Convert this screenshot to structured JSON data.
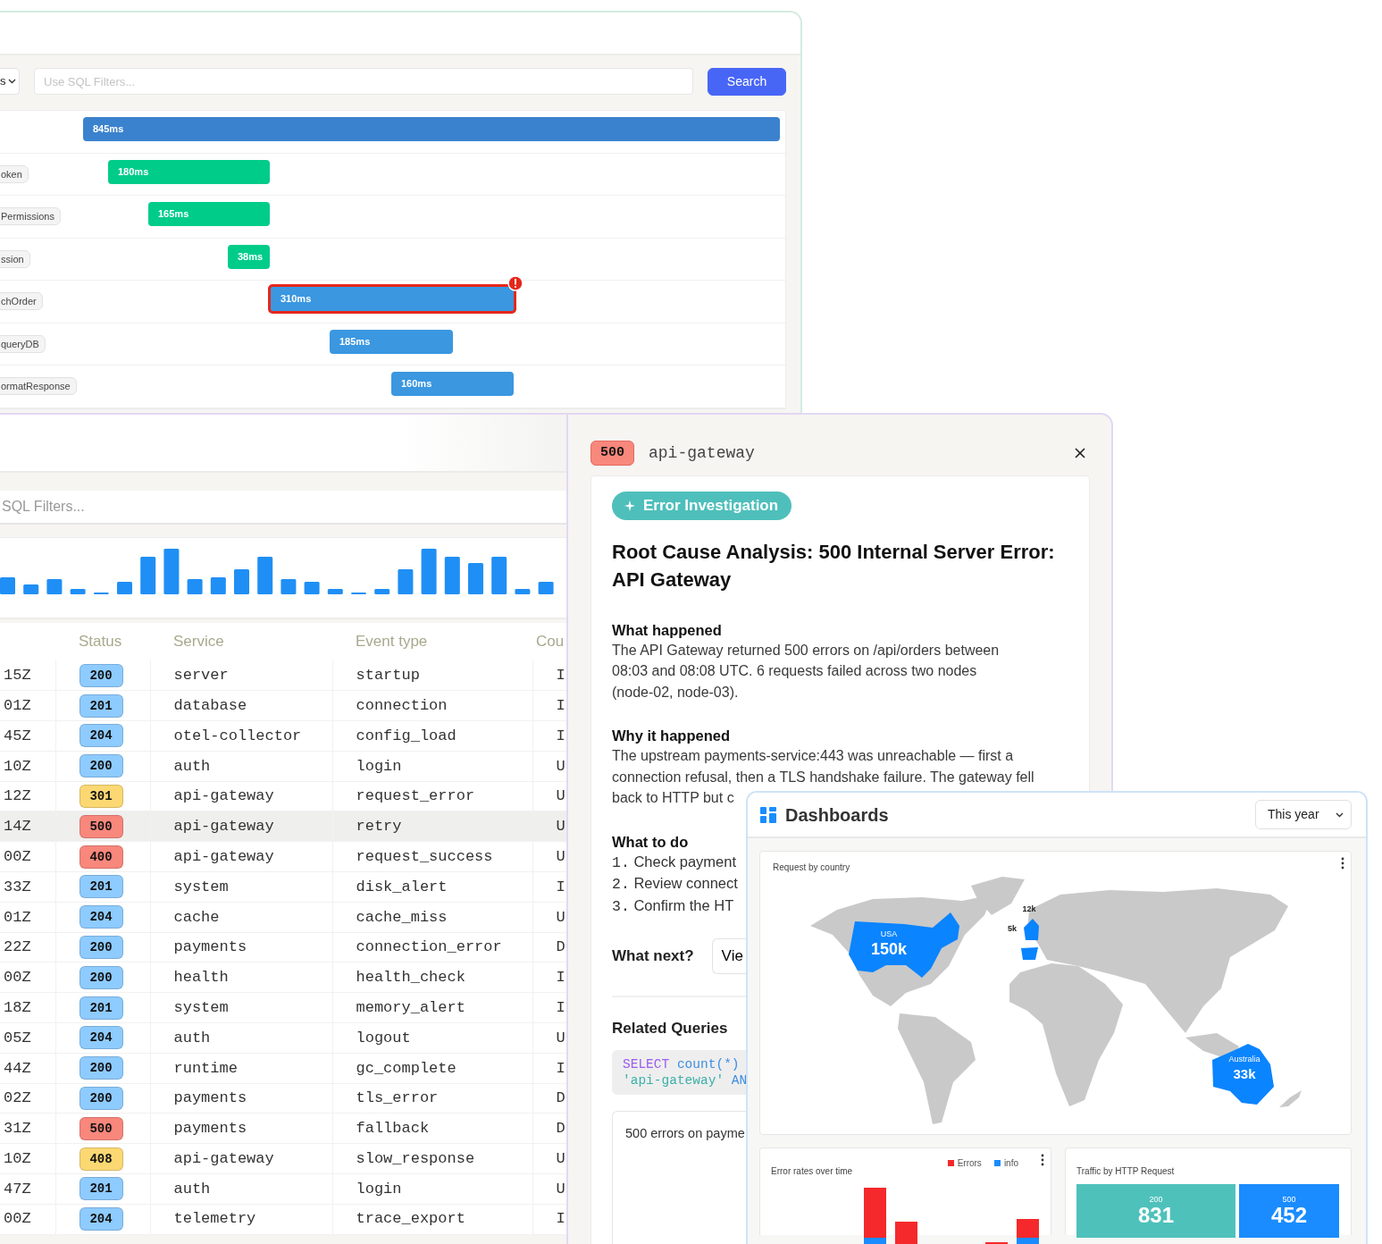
{
  "trace_window": {
    "filter": {
      "select": "s",
      "placeholder": "Use SQL Filters...",
      "button": "Search"
    },
    "spans": [
      {
        "duration": "845ms",
        "color": "#3b82ce",
        "error": false
      },
      {
        "label": "oken",
        "duration": "180ms",
        "color": "#00cc8a",
        "error": false
      },
      {
        "label": "Permissions",
        "duration": "165ms",
        "color": "#00cc8a",
        "error": false
      },
      {
        "label": "ssion",
        "duration": "38ms",
        "color": "#00cc8a",
        "error": false
      },
      {
        "label": "chOrder",
        "duration": "310ms",
        "color": "#3a97e0",
        "error": true
      },
      {
        "label": "queryDB",
        "duration": "185ms",
        "color": "#3a97e0",
        "error": false
      },
      {
        "label": "ormatResponse",
        "duration": "160ms",
        "color": "#3a97e0",
        "error": false
      }
    ]
  },
  "logs_window": {
    "filter": {
      "placeholder": "SQL Filters..."
    },
    "table": {
      "columns": [
        "Status",
        "Service",
        "Event type",
        "Cou"
      ],
      "rows": [
        {
          "time": "15Z",
          "status": "200",
          "color": "#8ecbff",
          "service": "server",
          "event": "startup",
          "column_5": "I",
          "selected": false
        },
        {
          "time": "01Z",
          "status": "201",
          "color": "#8ecbff",
          "service": "database",
          "event": "connection",
          "column_5": "I",
          "selected": false
        },
        {
          "time": "45Z",
          "status": "204",
          "color": "#8ecbff",
          "service": "otel-collector",
          "event": "config_load",
          "column_5": "I",
          "selected": false
        },
        {
          "time": "10Z",
          "status": "200",
          "color": "#8ecbff",
          "service": "auth",
          "event": "login",
          "column_5": "U",
          "selected": false
        },
        {
          "time": "12Z",
          "status": "301",
          "color": "#fcd873",
          "service": "api-gateway",
          "event": "request_error",
          "column_5": "U",
          "selected": false
        },
        {
          "time": "14Z",
          "status": "500",
          "color": "#f8877c",
          "service": "api-gateway",
          "event": "retry",
          "column_5": "U",
          "selected": true
        },
        {
          "time": "00Z",
          "status": "400",
          "color": "#f8877c",
          "service": "api-gateway",
          "event": "request_success",
          "column_5": "U",
          "selected": false
        },
        {
          "time": "33Z",
          "status": "201",
          "color": "#8ecbff",
          "service": "system",
          "event": "disk_alert",
          "column_5": "I",
          "selected": false
        },
        {
          "time": "01Z",
          "status": "204",
          "color": "#8ecbff",
          "service": "cache",
          "event": "cache_miss",
          "column_5": "U",
          "selected": false
        },
        {
          "time": "22Z",
          "status": "200",
          "color": "#8ecbff",
          "service": "payments",
          "event": "connection_error",
          "column_5": "D",
          "selected": false
        },
        {
          "time": "00Z",
          "status": "200",
          "color": "#8ecbff",
          "service": "health",
          "event": "health_check",
          "column_5": "I",
          "selected": false
        },
        {
          "time": "18Z",
          "status": "201",
          "color": "#8ecbff",
          "service": "system",
          "event": "memory_alert",
          "column_5": "I",
          "selected": false
        },
        {
          "time": "05Z",
          "status": "204",
          "color": "#8ecbff",
          "service": "auth",
          "event": "logout",
          "column_5": "U",
          "selected": false
        },
        {
          "time": "44Z",
          "status": "200",
          "color": "#8ecbff",
          "service": "runtime",
          "event": "gc_complete",
          "column_5": "I",
          "selected": false
        },
        {
          "time": "02Z",
          "status": "200",
          "color": "#8ecbff",
          "service": "payments",
          "event": "tls_error",
          "column_5": "D",
          "selected": false
        },
        {
          "time": "31Z",
          "status": "500",
          "color": "#f8877c",
          "service": "payments",
          "event": "fallback",
          "column_5": "D",
          "selected": false
        },
        {
          "time": "10Z",
          "status": "408",
          "color": "#fcd873",
          "service": "api-gateway",
          "event": "slow_response",
          "column_5": "U",
          "selected": false
        },
        {
          "time": "47Z",
          "status": "201",
          "color": "#8ecbff",
          "service": "auth",
          "event": "login",
          "column_5": "U",
          "selected": false
        },
        {
          "time": "00Z",
          "status": "204",
          "color": "#8ecbff",
          "service": "telemetry",
          "event": "trace_export",
          "column_5": "I",
          "selected": false
        }
      ]
    }
  },
  "detail": {
    "status": "500",
    "service": "api-gateway",
    "tag": "Error Investigation",
    "title": "Root Cause Analysis: 500 Internal Server Error: API Gateway",
    "sections": [
      {
        "heading": "What happened",
        "lines": [
          "The API Gateway returned 500 errors on /api/orders between",
          "08:03 and 08:08 UTC. 6 requests failed across two nodes",
          "(node-02, node-03)."
        ]
      },
      {
        "heading": "Why it happened",
        "lines": [
          "The upstream payments-service:443 was unreachable — first a",
          "connection refusal, then a TLS handshake failure. The gateway fell",
          "back to HTTP but c"
        ]
      }
    ],
    "todo": {
      "heading": "What to do",
      "steps": [
        {
          "number": "1.",
          "text": "Check payment"
        },
        {
          "number": "2.",
          "text": "Review connect"
        },
        {
          "number": "3.",
          "text": "Confirm the HT"
        }
      ]
    },
    "next": {
      "label": "What next?",
      "button": "Vie"
    },
    "related": {
      "heading": "Related Queries",
      "query_lines": [
        [
          {
            "text": "SELECT",
            "kind": "keyword"
          },
          {
            "text": "count(*)",
            "kind": "function"
          }
        ],
        [
          {
            "text": "'api-gateway'",
            "kind": "string"
          },
          {
            "text": "AN",
            "kind": "function"
          }
        ]
      ],
      "saved_query": "500 errors on payme"
    }
  },
  "dashboard": {
    "title": "Dashboards",
    "range": "This year",
    "map": {
      "title": "Request by country",
      "labels": [
        {
          "country": "USA",
          "value": "150k"
        },
        {
          "value": "12k"
        },
        {
          "value": "5k"
        },
        {
          "country": "Australia",
          "value": "33k"
        }
      ]
    },
    "error_chart": {
      "title": "Error rates over time",
      "legend": [
        {
          "label": "Errors",
          "color": "#f5292b"
        },
        {
          "label": "info",
          "color": "#1a8cff"
        }
      ]
    },
    "traffic": {
      "title": "Traffic by HTTP Request",
      "tiles": [
        {
          "label": "200",
          "value": "831",
          "color": "#4fc1bb"
        },
        {
          "label": "500",
          "value": "452",
          "color": "#1a8cff"
        }
      ]
    }
  }
}
